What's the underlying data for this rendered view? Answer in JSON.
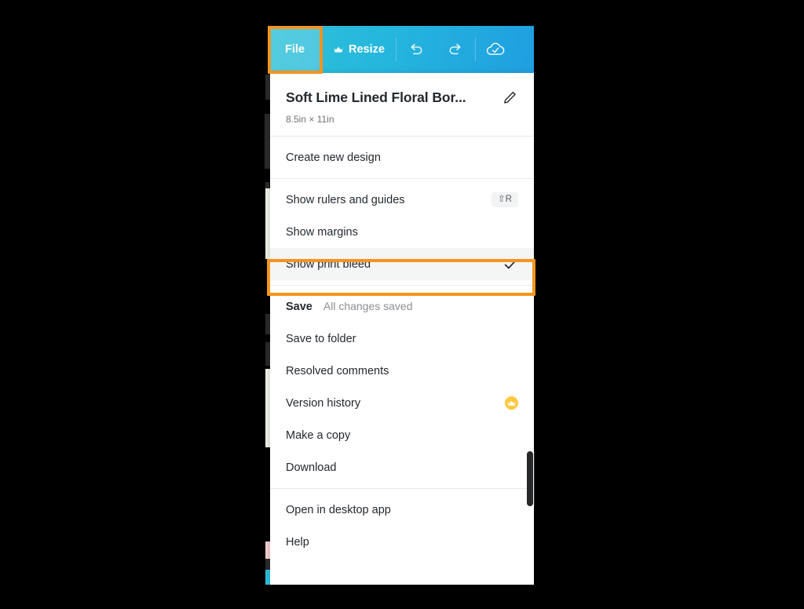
{
  "toolbar": {
    "file_label": "File",
    "resize_label": "Resize",
    "resize_icon": "crown-icon",
    "undo_icon": "undo-icon",
    "redo_icon": "redo-icon",
    "cloud_saved_icon": "cloud-check-icon",
    "background_gradient_from": "#2fc2d8",
    "background_gradient_to": "#1f9fe0"
  },
  "design": {
    "title": "Soft Lime Lined Floral Bor...",
    "dimensions": "8.5in × 11in",
    "edit_icon": "pencil-icon"
  },
  "menu": {
    "groups": [
      {
        "items": [
          {
            "label": "Create new design",
            "icon": "",
            "shortcut": "",
            "sub_label": "",
            "badge": ""
          }
        ]
      },
      {
        "items": [
          {
            "label": "Show rulers and guides",
            "shortcut": "⇧R",
            "sub_label": "",
            "badge": ""
          },
          {
            "label": "Show margins",
            "shortcut": "",
            "sub_label": "",
            "badge": ""
          },
          {
            "label": "Show print bleed",
            "shortcut": "",
            "sub_label": "",
            "badge": "check-icon"
          }
        ]
      },
      {
        "items": [
          {
            "label": "Save",
            "sub_label": "All changes saved",
            "shortcut": "",
            "badge": ""
          },
          {
            "label": "Save to folder",
            "sub_label": "",
            "shortcut": "",
            "badge": ""
          },
          {
            "label": "Resolved comments",
            "sub_label": "",
            "shortcut": "",
            "badge": ""
          },
          {
            "label": "Version history",
            "sub_label": "",
            "shortcut": "",
            "badge": "pro-crown-badge"
          },
          {
            "label": "Make a copy",
            "sub_label": "",
            "shortcut": "",
            "badge": ""
          },
          {
            "label": "Download",
            "sub_label": "",
            "shortcut": "",
            "badge": ""
          }
        ]
      },
      {
        "items": [
          {
            "label": "Open in desktop app",
            "sub_label": "",
            "shortcut": "",
            "badge": ""
          },
          {
            "label": "Help",
            "sub_label": "",
            "shortcut": "",
            "badge": ""
          }
        ]
      }
    ]
  },
  "annotations": {
    "highlight_color": "#f5941f",
    "highlighted_elements": [
      "File",
      "Show print bleed"
    ]
  }
}
